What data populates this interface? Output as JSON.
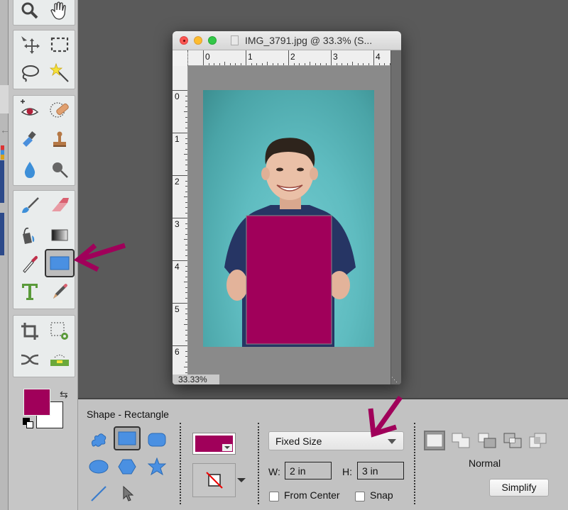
{
  "toolbox": {
    "groups": [
      {
        "name": "view",
        "tools": [
          "zoom-tool",
          "hand-tool"
        ]
      },
      {
        "name": "select",
        "tools": [
          "move-tool",
          "rectangular-marquee-tool",
          "lasso-tool",
          "magic-wand-tool"
        ]
      },
      {
        "name": "enhance",
        "tools": [
          "red-eye-removal-tool",
          "spot-healing-brush-tool",
          "smart-brush-tool",
          "clone-stamp-tool",
          "blur-tool",
          "sponge-tool"
        ]
      },
      {
        "name": "draw",
        "tools": [
          "brush-tool",
          "eraser-tool",
          "paint-bucket-tool",
          "gradient-tool",
          "color-picker-tool",
          "shape-tool",
          "type-tool",
          "pencil-tool"
        ]
      },
      {
        "name": "modify",
        "tools": [
          "crop-tool",
          "recompose-tool",
          "content-aware-move-tool",
          "straighten-tool"
        ]
      }
    ],
    "active_tool": "shape-tool",
    "foreground_color": "#a0005a",
    "background_color": "#ffffff"
  },
  "document": {
    "title": "IMG_3791.jpg @ 33.3% (S...",
    "zoom_readout": "33.33%",
    "ruler_h_labels": [
      "0",
      "1",
      "2",
      "3",
      "4"
    ],
    "ruler_v_labels": [
      "0",
      "1",
      "2",
      "3",
      "4",
      "5",
      "6"
    ],
    "shape_fill_color": "#a0005a",
    "backdrop_color": "#5fbcc0"
  },
  "options": {
    "title": "Shape - Rectangle",
    "shapes": [
      "custom-shape",
      "rectangle",
      "rounded-rectangle",
      "ellipse",
      "polygon",
      "star",
      "line",
      "shape-selection"
    ],
    "active_shape": "rectangle",
    "fill_color": "#a0005a",
    "size_mode": "Fixed Size",
    "width_label": "W:",
    "width_value": "2 in",
    "height_label": "H:",
    "height_value": "3 in",
    "from_center_label": "From Center",
    "snap_label": "Snap",
    "combine_mode_label": "Normal",
    "simplify_label": "Simplify"
  },
  "annotations": {
    "arrow_color": "#a0005a"
  }
}
